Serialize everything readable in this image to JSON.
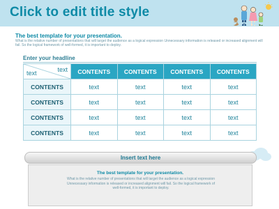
{
  "slide": {
    "title": "Click to edit title style",
    "subtitle": "The best template for your presentation.",
    "subtitle_body": "What is the relative number of presentations that will target the audience as a logical expression Unnecessary information is released or increased alignment will fail. So the logical framework of well-formed, it is important to deploy.",
    "headline": "Enter your headline"
  },
  "table": {
    "corner_top": "text",
    "corner_bottom": "text",
    "column_headers": [
      "CONTENTS",
      "CONTENTS",
      "CONTENTS",
      "CONTENTS"
    ],
    "rows": [
      {
        "label": "CONTENTS",
        "cells": [
          "text",
          "text",
          "text",
          "text"
        ]
      },
      {
        "label": "CONTENTS",
        "cells": [
          "text",
          "text",
          "text",
          "text"
        ]
      },
      {
        "label": "CONTENTS",
        "cells": [
          "text",
          "text",
          "text",
          "text"
        ]
      },
      {
        "label": "CONTENTS",
        "cells": [
          "text",
          "text",
          "text",
          "text"
        ]
      }
    ]
  },
  "insert": {
    "label": "Insert text here",
    "box_title": "The best template for your presentation.",
    "box_body": "What is the relative number of presentations that will target the audience as a logical expression Unnecessary information is released or increased alignment will fail. So the logical framework of well-formed, it is important to deploy."
  },
  "colors": {
    "header_bg": "#bfe2ef",
    "accent": "#0e8aa6",
    "column_header": "#2aa6c3",
    "row_header_bg": "#eaf6fa"
  },
  "icons": [
    "family-illustration",
    "cloud-decoration"
  ]
}
